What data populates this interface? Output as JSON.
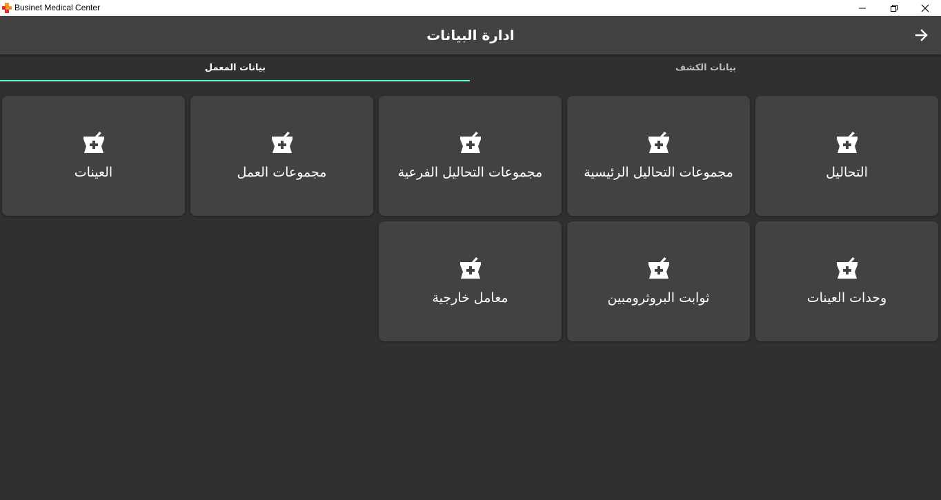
{
  "window": {
    "title": "Businet Medical Center"
  },
  "appbar": {
    "title": "ادارة البيانات",
    "back_icon": "arrow-right-icon"
  },
  "tabs": [
    {
      "label": "بيانات المعمل",
      "active": true
    },
    {
      "label": "بيانات الكشف",
      "active": false
    }
  ],
  "cards": [
    {
      "label": "التحاليل",
      "icon": "mortar-pestle-plus-icon"
    },
    {
      "label": "مجموعات التحاليل الرئيسية",
      "icon": "mortar-pestle-plus-icon"
    },
    {
      "label": "مجموعات التحاليل الفرعية",
      "icon": "mortar-pestle-plus-icon"
    },
    {
      "label": "مجموعات العمل",
      "icon": "mortar-pestle-plus-icon"
    },
    {
      "label": "العينات",
      "icon": "mortar-pestle-plus-icon"
    },
    {
      "label": "وحدات العينات",
      "icon": "mortar-pestle-plus-icon"
    },
    {
      "label": "ثوابت البروثرومبين",
      "icon": "mortar-pestle-plus-icon"
    },
    {
      "label": "معامل خارجية",
      "icon": "mortar-pestle-plus-icon"
    }
  ],
  "colors": {
    "background": "#303030",
    "surface": "#424242",
    "accent": "#64ffda",
    "text": "#ffffff"
  }
}
